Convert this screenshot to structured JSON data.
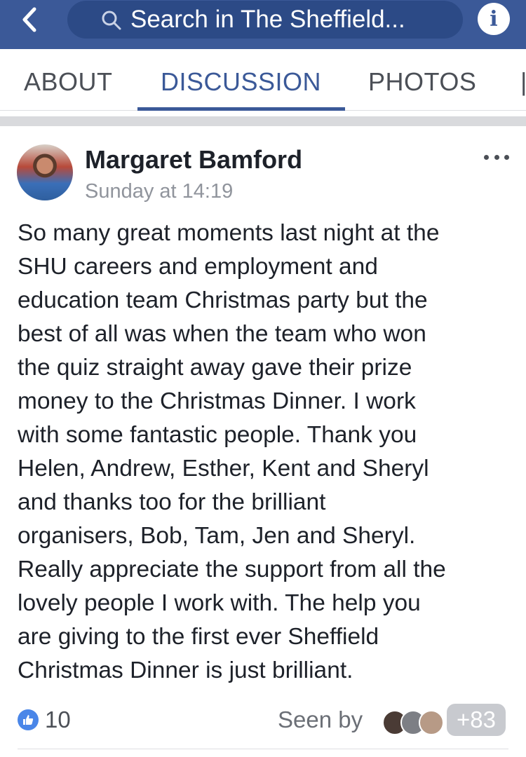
{
  "header": {
    "search_placeholder": "Search in The Sheffield...",
    "back_icon": "chevron-left-icon",
    "search_icon": "search-icon",
    "info_label": "i",
    "bar_color": "#3b5998"
  },
  "tabs": [
    {
      "label": "ABOUT",
      "active": false
    },
    {
      "label": "DISCUSSION",
      "active": true
    },
    {
      "label": "PHOTOS",
      "active": false
    }
  ],
  "post": {
    "author": "Margaret Bamford",
    "timestamp": "Sunday at 14:19",
    "lines": [
      "So many great moments last night at the",
      "SHU careers and employment and",
      "education team Christmas party but the",
      "best of all was when the team who won",
      "the quiz straight away gave their prize",
      "money to the Christmas Dinner. I work",
      "with some fantastic people. Thank you",
      "Helen, Andrew, Esther, Kent and Sheryl",
      "and thanks too for the brilliant",
      "organisers, Bob, Tam, Jen and Sheryl.",
      "Really appreciate the support from all the",
      "lovely people I work with. The help you",
      "are giving to the first ever Sheffield",
      "Christmas Dinner is just brilliant."
    ],
    "likes": "10",
    "seen_by_label": "Seen by",
    "seen_more": "+83"
  }
}
